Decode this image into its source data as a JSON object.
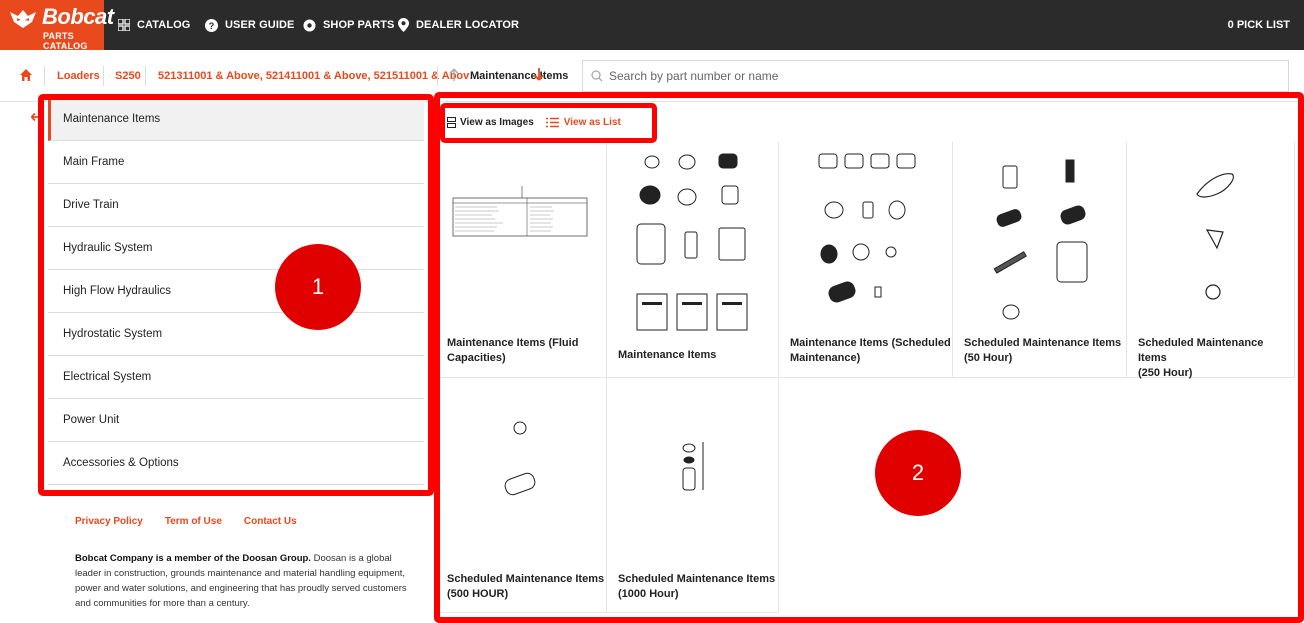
{
  "app": {
    "brand": "Bobcat",
    "brand_sub": "PARTS CATALOG",
    "brand_color": "#e8491d"
  },
  "nav": {
    "items": [
      {
        "label": "CATALOG",
        "icon": "grid-icon"
      },
      {
        "label": "USER GUIDE",
        "icon": "question-circle-icon"
      },
      {
        "label": "SHOP PARTS",
        "icon": "gear-icon"
      },
      {
        "label": "DEALER LOCATOR",
        "icon": "map-pin-icon"
      }
    ],
    "picklist": "0  PICK LIST"
  },
  "breadcrumb": {
    "items": [
      "Loaders",
      "S250",
      "521311001 & Above, 521411001 & Above, 521511001 & Abov…"
    ],
    "current_category": "Maintenance Items"
  },
  "search": {
    "placeholder": "Search by part number or name"
  },
  "sidebar": {
    "items": [
      {
        "label": "Maintenance Items",
        "active": true
      },
      {
        "label": "Main Frame"
      },
      {
        "label": "Drive Train"
      },
      {
        "label": "Hydraulic System"
      },
      {
        "label": "High Flow Hydraulics"
      },
      {
        "label": "Hydrostatic System"
      },
      {
        "label": "Electrical System"
      },
      {
        "label": "Power Unit"
      },
      {
        "label": "Accessories & Options"
      }
    ]
  },
  "view": {
    "images_label": "View as Images",
    "list_label": "View as List"
  },
  "cards": [
    {
      "title_line1": "Maintenance Items (Fluid",
      "title_line2": "Capacities)"
    },
    {
      "title_line1": "Maintenance Items",
      "title_line2": ""
    },
    {
      "title_line1": "Maintenance Items (Scheduled",
      "title_line2": "Maintenance)"
    },
    {
      "title_line1": "Scheduled Maintenance Items",
      "title_line2": "(50 Hour)"
    },
    {
      "title_line1": "Scheduled Maintenance Items",
      "title_line2": "(250 Hour)"
    },
    {
      "title_line1": "Scheduled Maintenance Items",
      "title_line2": "(500 HOUR)"
    },
    {
      "title_line1": "Scheduled Maintenance Items",
      "title_line2": "(1000 Hour)"
    }
  ],
  "footer": {
    "links": [
      "Privacy Policy",
      "Term of Use",
      "Contact Us"
    ],
    "company_bold": "Bobcat Company is a member of the Doosan Group.",
    "company_text": " Doosan is a global leader in construction, grounds maintenance and material handling equipment, power and water solutions, and engineering that has proudly served customers and communities for more than a century."
  },
  "annotations": [
    {
      "label": "1"
    },
    {
      "label": "2"
    }
  ]
}
